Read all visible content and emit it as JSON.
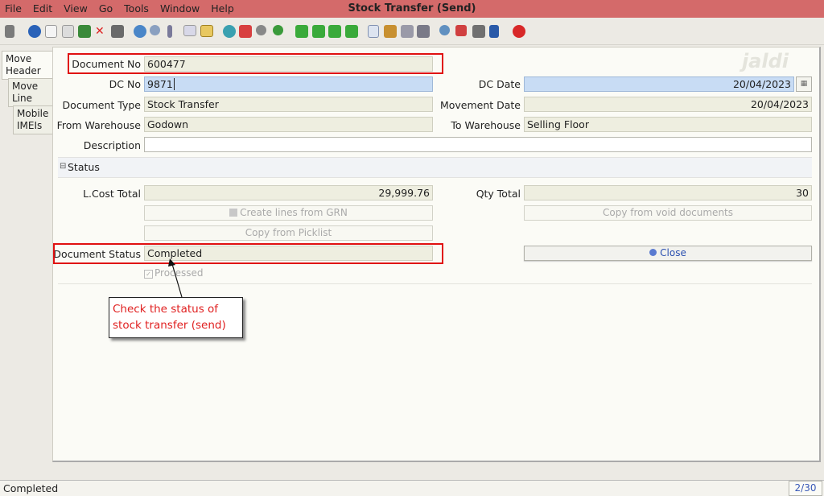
{
  "window": {
    "title": "Stock Transfer (Send)"
  },
  "menu": [
    "File",
    "Edit",
    "View",
    "Go",
    "Tools",
    "Window",
    "Help"
  ],
  "watermark": "jaldi",
  "tabs": {
    "header": "Move Header",
    "line": "Move Line",
    "imeis": "Mobile IMEIs"
  },
  "labels": {
    "document_no": "Document No",
    "dc_no": "DC No",
    "dc_date": "DC Date",
    "document_type": "Document Type",
    "movement_date": "Movement Date",
    "from_warehouse": "From Warehouse",
    "to_warehouse": "To Warehouse",
    "description": "Description",
    "status_section": "Status",
    "lcost_total": "L.Cost Total",
    "qty_total": "Qty Total",
    "document_status": "Document Status",
    "processed": "Processed"
  },
  "values": {
    "document_no": "600477",
    "dc_no": "9871",
    "dc_date": "20/04/2023",
    "document_type": "Stock Transfer",
    "movement_date": "20/04/2023",
    "from_warehouse": "Godown",
    "to_warehouse": "Selling Floor",
    "description": "",
    "lcost_total": "29,999.76",
    "qty_total": "30",
    "document_status": "Completed"
  },
  "buttons": {
    "create_lines_grn": "Create lines from GRN",
    "copy_void": "Copy from void documents",
    "copy_picklist": "Copy from Picklist",
    "close": "Close"
  },
  "annotation": {
    "text": "Check the status of stock transfer (send)"
  },
  "statusbar": {
    "message": "Completed",
    "record": "2/30"
  },
  "colors": {
    "titlebar": "#d46a6a",
    "highlight": "#e01010",
    "callout_text": "#e02020"
  }
}
